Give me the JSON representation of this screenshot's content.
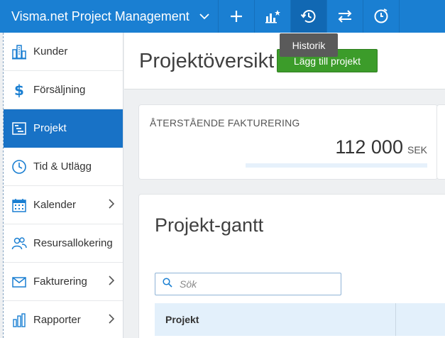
{
  "topbar": {
    "app_title": "Visma.net Project Management",
    "buttons": [
      {
        "name": "add",
        "icon": "plus-icon"
      },
      {
        "name": "stats",
        "icon": "chart-star-icon"
      },
      {
        "name": "history",
        "icon": "history-icon",
        "active": true
      },
      {
        "name": "switch",
        "icon": "swap-arrows-icon"
      },
      {
        "name": "timer",
        "icon": "clock-check-icon"
      }
    ],
    "tooltip": "Historik"
  },
  "sidebar": {
    "items": [
      {
        "label": "Kunder",
        "icon": "buildings-icon",
        "chevron": false
      },
      {
        "label": "Försäljning",
        "icon": "dollar-icon",
        "chevron": false
      },
      {
        "label": "Projekt",
        "icon": "project-icon",
        "chevron": false,
        "active": true
      },
      {
        "label": "Tid & Utlägg",
        "icon": "clock-icon",
        "chevron": false
      },
      {
        "label": "Kalender",
        "icon": "calendar-icon",
        "chevron": true
      },
      {
        "label": "Resursallokering",
        "icon": "people-icon",
        "chevron": false
      },
      {
        "label": "Fakturering",
        "icon": "envelope-icon",
        "chevron": true
      },
      {
        "label": "Rapporter",
        "icon": "bar-chart-icon",
        "chevron": true
      }
    ]
  },
  "main": {
    "page_title": "Projektöversikt",
    "add_button_label": "Lägg till projekt",
    "billing": {
      "label": "ÅTERSTÅENDE FAKTURERING",
      "amount": "112 000",
      "currency": "SEK"
    },
    "gantt": {
      "title": "Projekt-gantt",
      "search_placeholder": "Sök",
      "columns": [
        "Projekt"
      ]
    }
  },
  "colors": {
    "topbar": "#1a7fd2",
    "active_nav": "#1872c6",
    "add_button": "#3c9c2a",
    "icon_blue": "#1a7fd2"
  }
}
